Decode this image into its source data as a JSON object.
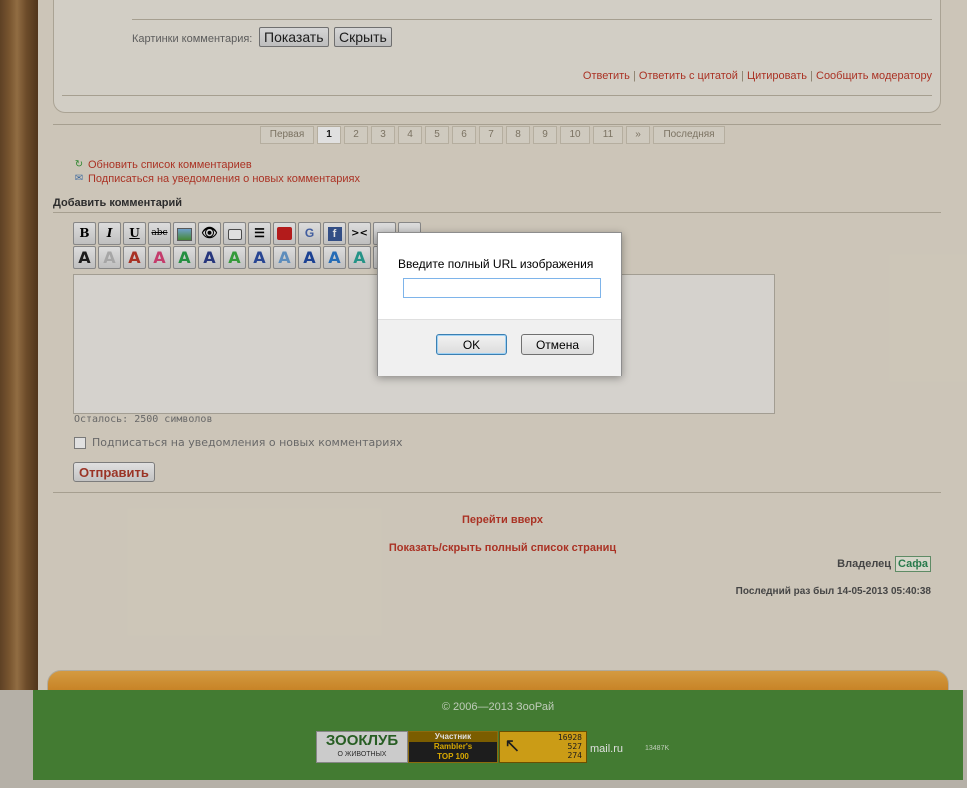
{
  "comment": {
    "pictures_label": "Картинки комментария:",
    "show_button": "Показать",
    "hide_button": "Скрыть",
    "actions": [
      "Ответить",
      "Ответить с цитатой",
      "Цитировать",
      "Сообщить модератору"
    ]
  },
  "pagination": {
    "first": "Первая",
    "pages": [
      "1",
      "2",
      "3",
      "4",
      "5",
      "6",
      "7",
      "8",
      "9",
      "10",
      "11"
    ],
    "next": "»",
    "last": "Последняя",
    "current": "1"
  },
  "links": {
    "refresh": "Обновить список комментариев",
    "subscribe": "Подписаться на уведомления о новых комментариях"
  },
  "add_comment": {
    "title": "Добавить комментарий",
    "toolbar_row1": [
      "bold",
      "italic",
      "underline",
      "strikethrough",
      "image",
      "spoiler",
      "quote",
      "list",
      "youtube",
      "google",
      "facebook",
      "collapse",
      "blank1",
      "blank2"
    ],
    "toolbar_labels": {
      "bold": "B",
      "italic": "I",
      "underline": "U",
      "strikethrough": "abc",
      "collapse": "><"
    },
    "color_buttons": [
      "#222222",
      "#bdbdbd",
      "#c0392b",
      "#e0457b",
      "#2aa34a",
      "#2c3e8f",
      "#3cb043",
      "#2d4fa8",
      "#6aa1d6",
      "#1f4aa8",
      "#2b7bd0",
      "#2aa89a",
      "#444444"
    ],
    "counter": "Осталось: 2500 символов",
    "subscribe_checkbox": "Подписаться на уведомления о новых комментариях",
    "send_button": "Отправить"
  },
  "bottom": {
    "go_top": "Перейти вверх",
    "toggle_pages": "Показать/скрыть полный список страниц",
    "owner_label": "Владелец",
    "owner_name": "Сафа",
    "last_seen": "Последний раз был 14-05-2013 05:40:38"
  },
  "footer": {
    "copyright": "© 2006—2013 ЗооРай",
    "zooclub_title": "ЗООКЛУБ",
    "zooclub_sub": "О ЖИВОТНЫХ",
    "rambler_line1": "Участник",
    "rambler_line2": "Rambler's",
    "rambler_line3": "TOP 100",
    "counter_values": [
      "16928",
      "527",
      "274"
    ],
    "mailru_label": "mail.ru",
    "mailru_count": "13487K"
  },
  "dialog": {
    "prompt": "Введите полный URL изображения",
    "input_value": "",
    "ok": "OK",
    "cancel": "Отмена"
  }
}
